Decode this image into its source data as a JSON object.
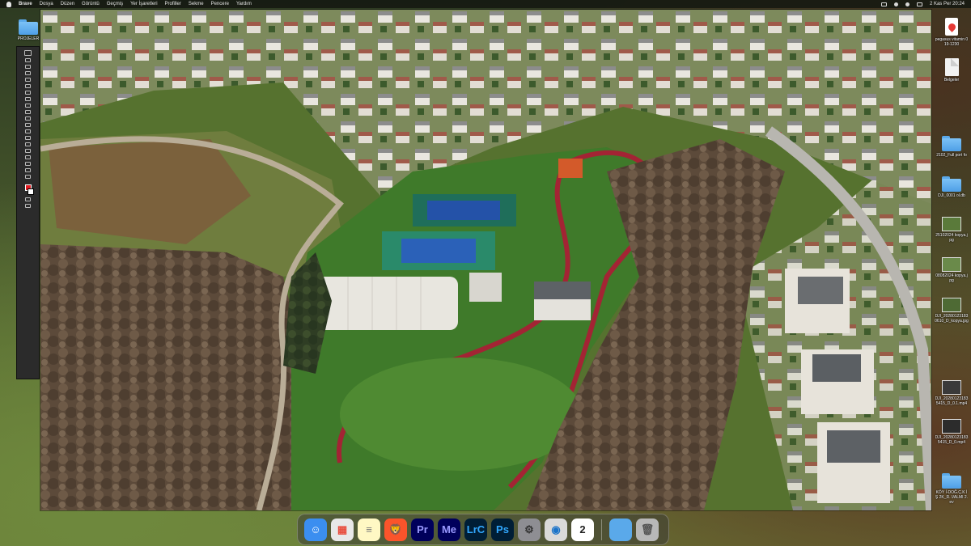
{
  "menubar": {
    "app_name": "Brave",
    "items": [
      "Dosya",
      "Düzen",
      "Görüntü",
      "Geçmiş",
      "Yer İşaretleri",
      "Profiller",
      "Sekme",
      "Pencere",
      "Yardım"
    ],
    "clock": "2 Kas Per 20:24"
  },
  "viewer": {
    "description_icon": "aerial-photo"
  },
  "desktop": {
    "left_icon": {
      "label": "PROJELER",
      "icon": "folder-icon"
    },
    "right_icons": [
      {
        "label": "pegasus vitamin 019-1230",
        "icon": "location-pin-icon"
      },
      {
        "label": "Belgeler",
        "icon": "document-icon"
      },
      {
        "label": "2102_Full port fo",
        "icon": "folder-icon"
      },
      {
        "label": "DJI_0001 ol.db",
        "icon": "folder-icon"
      },
      {
        "label": "25102024 kopya.jpg",
        "icon": "image-icon"
      },
      {
        "label": "08082024 kopya.jpg",
        "icon": "image-icon"
      },
      {
        "label": "DJI_20280123183 0610_D_kopya.jpg",
        "icon": "image-icon"
      },
      {
        "label": "DJI_20280123183 5415_D_0.1.mp4",
        "icon": "video-icon"
      },
      {
        "label": "DJI_20280123183 5415_D_0.mp4",
        "icon": "video-icon"
      },
      {
        "label": "DJI_20280123183 5451_D_0_2.mp4",
        "icon": "video-icon"
      },
      {
        "label": "KÖY İ-DOĞ.Ç.K İŞ 2K_R..VALMI 2.ev",
        "icon": "folder-icon"
      }
    ]
  },
  "dock": {
    "apps": [
      {
        "name": "Finder",
        "glyph": "☺",
        "bg": "#3b8ef0",
        "fg": "#ffffff"
      },
      {
        "name": "Launchpad",
        "glyph": "▦",
        "bg": "#e8e8e8",
        "fg": "#e84c3d"
      },
      {
        "name": "Notes",
        "glyph": "≡",
        "bg": "#fff8c4",
        "fg": "#777777"
      },
      {
        "name": "Brave",
        "glyph": "🦁",
        "bg": "#fb542b",
        "fg": "#ffffff"
      },
      {
        "name": "Premiere Pro",
        "glyph": "Pr",
        "bg": "#00005b",
        "fg": "#9999ff"
      },
      {
        "name": "Media Encoder",
        "glyph": "Me",
        "bg": "#00005b",
        "fg": "#9999ff"
      },
      {
        "name": "Lightroom Classic",
        "glyph": "LrC",
        "bg": "#001e36",
        "fg": "#31a8ff"
      },
      {
        "name": "Photoshop",
        "glyph": "Ps",
        "bg": "#001e36",
        "fg": "#31a8ff"
      },
      {
        "name": "System Settings",
        "glyph": "⚙",
        "bg": "#8e8e93",
        "fg": "#333333"
      },
      {
        "name": "QuickTime",
        "glyph": "◉",
        "bg": "#d9d9d9",
        "fg": "#1a73c9"
      },
      {
        "name": "Calendar",
        "glyph": "2",
        "bg": "#ffffff",
        "fg": "#222222"
      }
    ],
    "right_items": [
      {
        "name": "Downloads",
        "glyph": "",
        "bg": "#5aa9ea",
        "fg": "#ffffff"
      },
      {
        "name": "Trash",
        "glyph": "🗑",
        "bg": "#b8b8b8",
        "fg": "#555555"
      }
    ]
  }
}
